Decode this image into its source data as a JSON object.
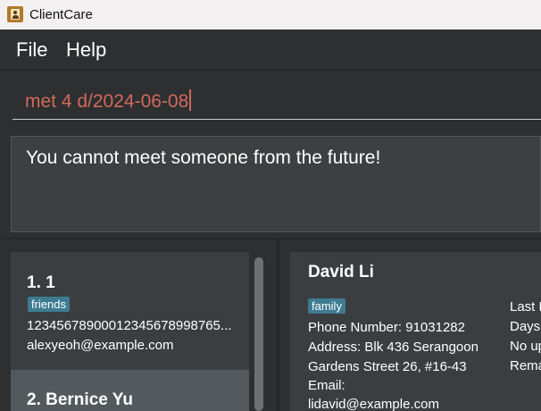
{
  "window": {
    "title": "ClientCare"
  },
  "menu": {
    "file": "File",
    "help": "Help"
  },
  "command": {
    "value": "met 4 d/2024-06-08"
  },
  "result": {
    "message": "You cannot meet someone from the future!"
  },
  "list": {
    "items": [
      {
        "index_name": "1.  1",
        "tag": "friends",
        "phone": "12345678900012345678998765...",
        "email": "alexyeoh@example.com"
      },
      {
        "index_name": "2.  Bernice Yu"
      }
    ]
  },
  "detail": {
    "name": "David Li",
    "tag": "family",
    "phone": "Phone Number: 91031282",
    "address_line1": "Address: Blk 436 Serangoon",
    "address_line2": "Gardens Street 26, #16-43",
    "email_label": "Email:",
    "email": "lidavid@example.com",
    "side": [
      "Last M",
      "Days s",
      "No up",
      "Remar"
    ]
  }
}
